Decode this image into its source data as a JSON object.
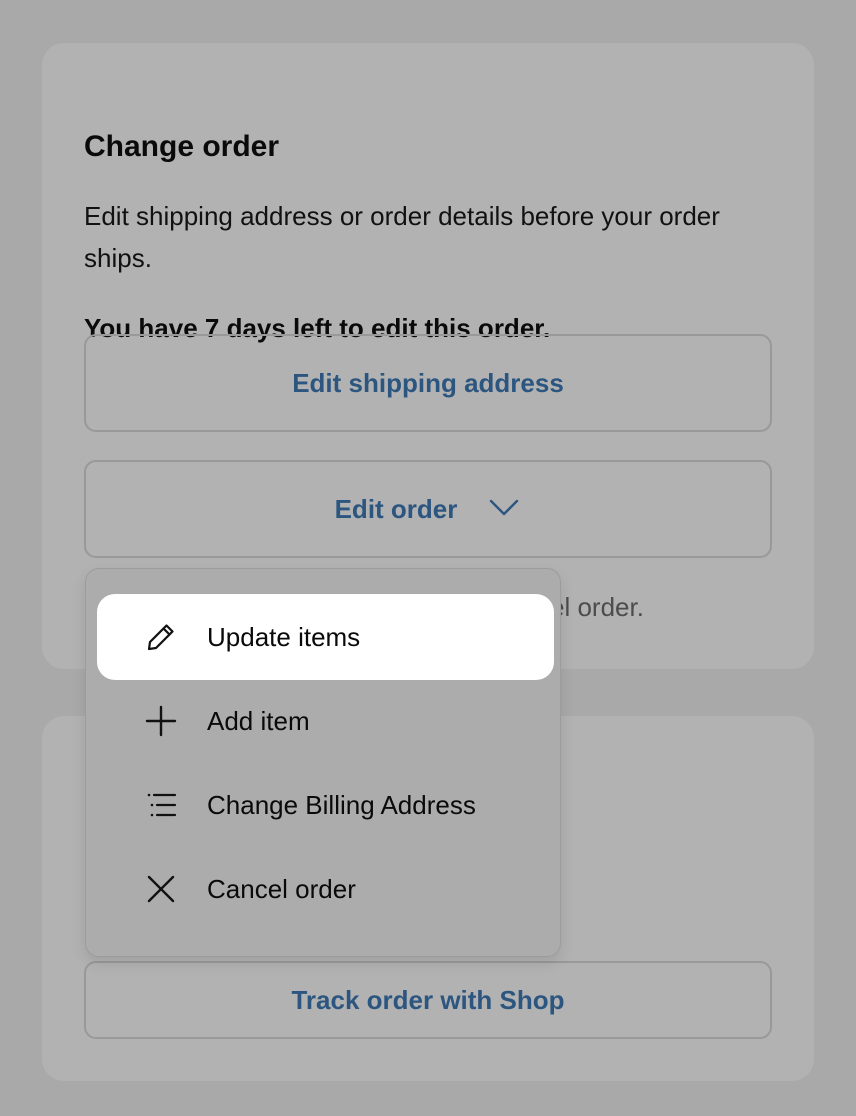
{
  "change_order": {
    "title": "Change order",
    "description": "Edit shipping address or order details before your order ships.",
    "notice": "You have 7 days left to edit this order.",
    "edit_shipping_label": "Edit shipping address",
    "edit_order_label": "Edit order",
    "partially_hidden_text": "…cel order."
  },
  "menu": {
    "items": [
      {
        "label": "Update items",
        "icon": "pencil-icon",
        "active": true
      },
      {
        "label": "Add item",
        "icon": "plus-icon",
        "active": false
      },
      {
        "label": "Change Billing Address",
        "icon": "list-icon",
        "active": false
      },
      {
        "label": "Cancel order",
        "icon": "close-icon",
        "active": false
      }
    ]
  },
  "track": {
    "track_label": "Track order with Shop"
  },
  "colors": {
    "page_background": "#a9a9a9",
    "card_background": "#b2b2b2",
    "link_blue": "#2c5680",
    "active_item_background": "#ffffff"
  }
}
